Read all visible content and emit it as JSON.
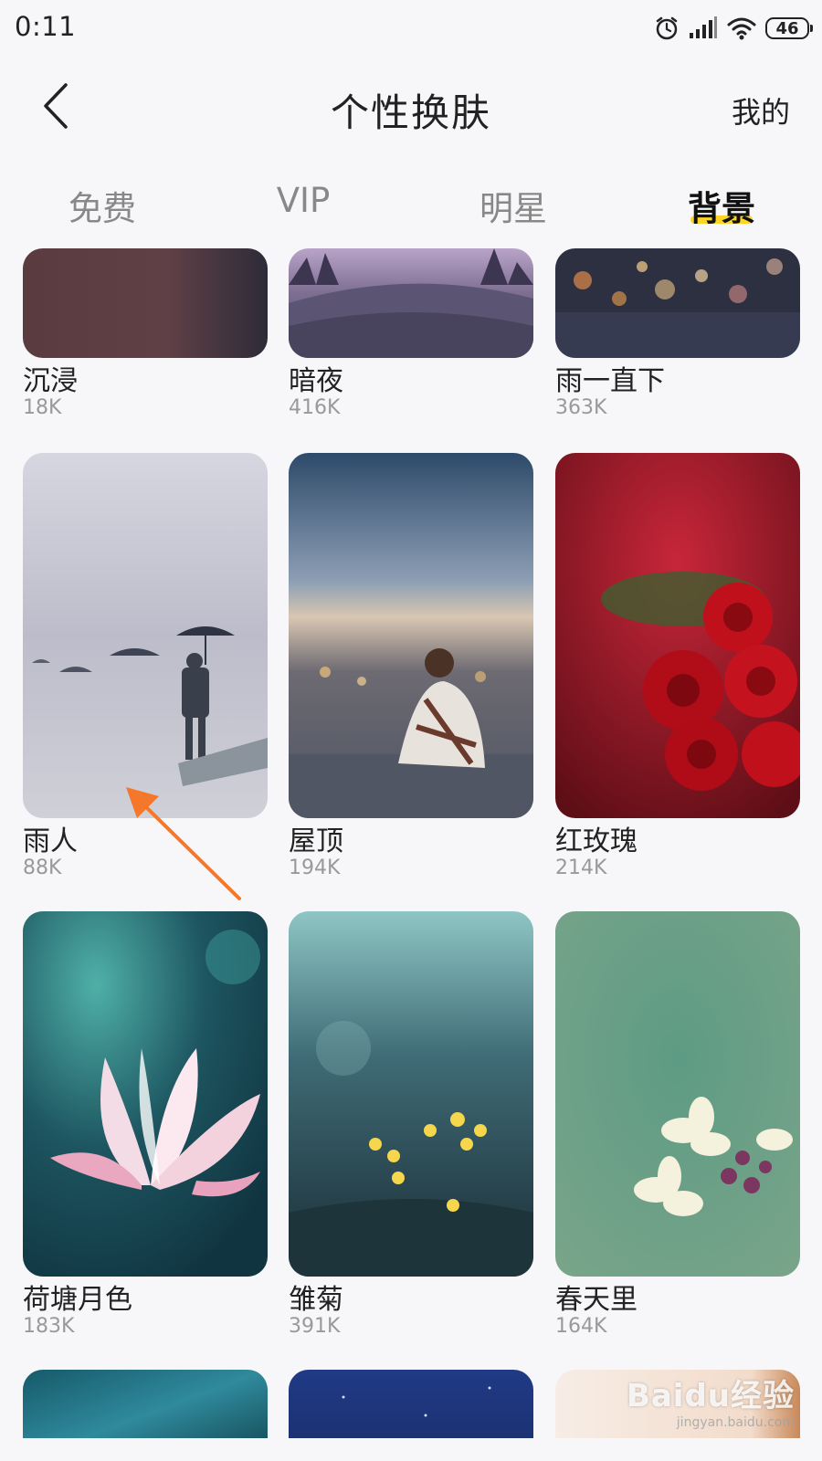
{
  "status_bar": {
    "time": "0:11",
    "battery": "46",
    "icons": [
      "alarm-icon",
      "signal-icon",
      "wifi-icon",
      "battery-icon"
    ]
  },
  "header": {
    "title": "个性换肤",
    "right_link": "我的",
    "back_icon": "chevron-left-icon"
  },
  "tabs": [
    {
      "label": "免费",
      "active": false
    },
    {
      "label": "VIP",
      "active": false
    },
    {
      "label": "明星",
      "active": false
    },
    {
      "label": "背景",
      "active": true
    }
  ],
  "colors": {
    "accent": "#ffd426",
    "annotation_arrow": "#f5782a"
  },
  "skins": [
    {
      "name": "沉浸",
      "size": "18K"
    },
    {
      "name": "暗夜",
      "size": "416K"
    },
    {
      "name": "雨一直下",
      "size": "363K"
    },
    {
      "name": "雨人",
      "size": "88K"
    },
    {
      "name": "屋顶",
      "size": "194K"
    },
    {
      "name": "红玫瑰",
      "size": "214K"
    },
    {
      "name": "荷塘月色",
      "size": "183K"
    },
    {
      "name": "雏菊",
      "size": "391K"
    },
    {
      "name": "春天里",
      "size": "164K"
    }
  ],
  "watermark": {
    "brand": "Baidu经验",
    "site": "jingyan.baidu.com"
  }
}
